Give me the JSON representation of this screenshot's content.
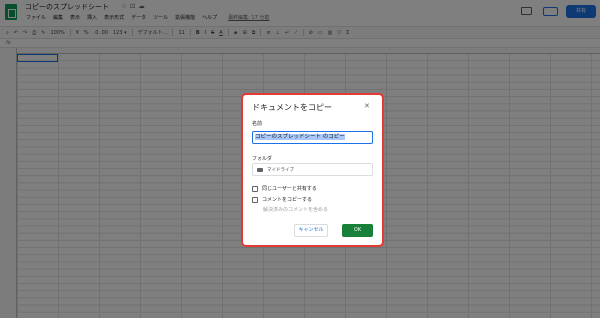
{
  "app": {
    "title": "コピーのスプレッドシート",
    "menu": [
      "ファイル",
      "編集",
      "表示",
      "挿入",
      "表示形式",
      "データ",
      "ツール",
      "拡張機能",
      "ヘルプ"
    ],
    "last_edit": "最終編集: 17 分前",
    "share_label": "共有"
  },
  "toolbar": {
    "zoom": "100%",
    "currency": "¥",
    "percent": "%",
    "decimals": ".0 .00",
    "number_format": "123 ▾",
    "font": "デフォルト...",
    "font_size": "11",
    "bold": "B",
    "italic": "I",
    "strike": "S",
    "text_color": "A"
  },
  "formula_bar": {
    "fx": "fx"
  },
  "dialog": {
    "title": "ドキュメントをコピー",
    "name_label": "名前",
    "name_value": "コピーのスプレッドシート のコピー",
    "folder_label": "フォルダ",
    "folder_value": "マイドライブ",
    "checkboxes": [
      {
        "label": "同じユーザーと共有する",
        "checked": false,
        "enabled": true
      },
      {
        "label": "コメントをコピーする",
        "checked": false,
        "enabled": true
      },
      {
        "label": "解決済みのコメントを含める",
        "checked": false,
        "enabled": false
      }
    ],
    "cancel_label": "キャンセル",
    "ok_label": "OK"
  },
  "colors": {
    "accent": "#1a73e8",
    "ok_green": "#188038",
    "highlight": "#e53935"
  }
}
